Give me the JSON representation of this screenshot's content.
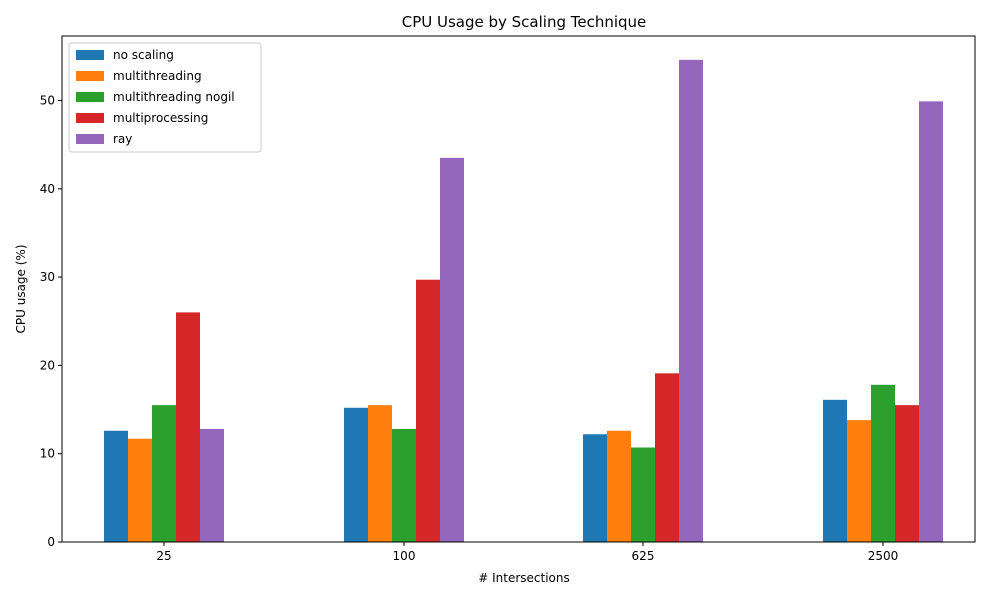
{
  "chart_data": {
    "type": "bar",
    "title": "CPU Usage by Scaling Technique",
    "xlabel": "# Intersections",
    "ylabel": "CPU usage (%)",
    "categories": [
      "25",
      "100",
      "625",
      "2500"
    ],
    "ylim": [
      0,
      57.3
    ],
    "yticks": [
      0,
      10,
      20,
      30,
      40,
      50
    ],
    "grid": false,
    "legend_position": "top-left",
    "series": [
      {
        "name": "no scaling",
        "color": "#1f77b4",
        "values": [
          12.6,
          15.2,
          12.2,
          16.1
        ]
      },
      {
        "name": "multithreading",
        "color": "#ff7f0e",
        "values": [
          11.7,
          15.5,
          12.6,
          13.8
        ]
      },
      {
        "name": "multithreading nogil",
        "color": "#2ca02c",
        "values": [
          15.5,
          12.8,
          10.7,
          17.8
        ]
      },
      {
        "name": "multiprocessing",
        "color": "#d62728",
        "values": [
          26.0,
          29.7,
          19.1,
          15.5
        ]
      },
      {
        "name": "ray",
        "color": "#9467bd",
        "values": [
          12.8,
          43.5,
          54.6,
          49.9
        ]
      }
    ]
  }
}
